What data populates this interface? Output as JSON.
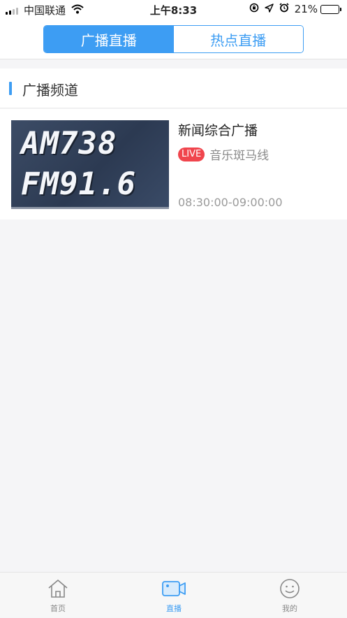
{
  "status_bar": {
    "carrier": "中国联通",
    "time": "上午8:33",
    "battery_text": "21%",
    "battery_level": 0.21
  },
  "nav": {
    "tabs": [
      {
        "label": "广播直播",
        "active": true
      },
      {
        "label": "热点直播",
        "active": false
      }
    ]
  },
  "section": {
    "title": "广播频道"
  },
  "channels": [
    {
      "thumb_line1": "AM738",
      "thumb_line2": "FM91.6",
      "name": "新闻综合广播",
      "live_badge": "LIVE",
      "program": "音乐斑马线",
      "time_range": "08:30:00-09:00:00"
    }
  ],
  "tabbar": {
    "items": [
      {
        "label": "首页",
        "icon": "home-icon",
        "active": false
      },
      {
        "label": "直播",
        "icon": "video-camera-icon",
        "active": true
      },
      {
        "label": "我的",
        "icon": "smiley-icon",
        "active": false
      }
    ]
  },
  "colors": {
    "accent": "#3d9df3",
    "live": "#f0454d"
  }
}
